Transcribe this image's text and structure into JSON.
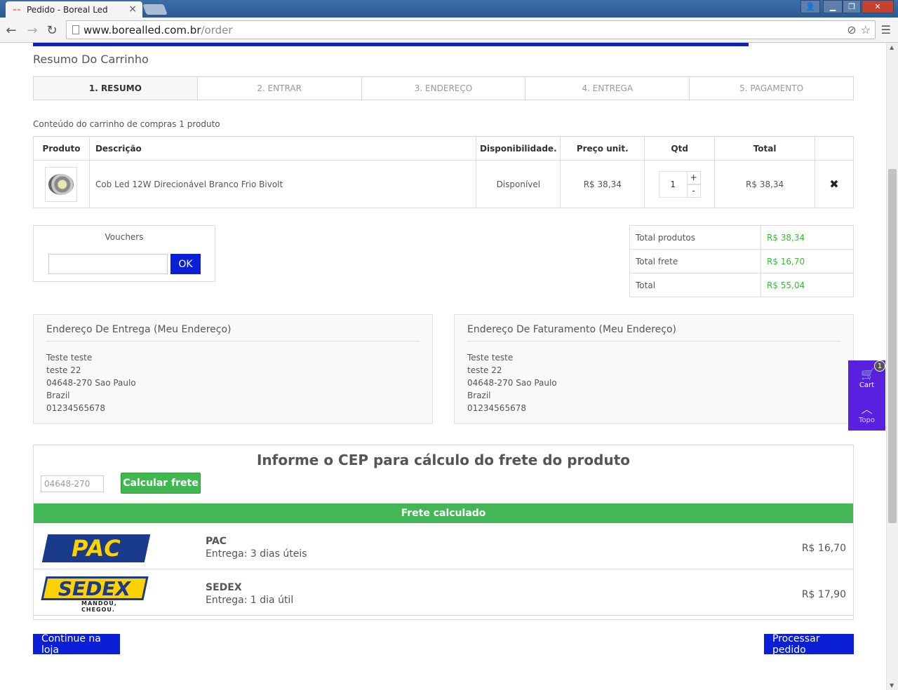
{
  "browser": {
    "tab_title": "Pedido - Boreal Led",
    "url_host": "www.borealled.com.br",
    "url_path": "/order"
  },
  "page": {
    "title": "Resumo Do Carrinho",
    "steps": [
      "1. RESUMO",
      "2. ENTRAR",
      "3. ENDEREÇO",
      "4. ENTREGA",
      "5. PAGAMENTO"
    ],
    "cart_summary": "Conteúdo do carrinho de compras 1 produto"
  },
  "cart_table": {
    "headers": [
      "Produto",
      "Descrição",
      "Disponibilidade.",
      "Preço unit.",
      "Qtd",
      "Total",
      ""
    ],
    "rows": [
      {
        "description": "Cob Led 12W Direcionável Branco Frio Bivolt",
        "availability": "Disponível",
        "unit_price": "R$ 38,34",
        "qty": "1",
        "total": "R$ 38,34"
      }
    ],
    "qty_plus": "+",
    "qty_minus": "-",
    "delete_glyph": "✖"
  },
  "vouchers": {
    "title": "Vouchers",
    "ok_label": "OK",
    "input_value": ""
  },
  "totals": [
    {
      "label": "Total produtos",
      "value": "R$ 38,34"
    },
    {
      "label": "Total frete",
      "value": "R$ 16,70"
    },
    {
      "label": "Total",
      "value": "R$ 55,04"
    }
  ],
  "delivery_address": {
    "title": "Endereço De Entrega (Meu Endereço)",
    "lines": [
      "Teste teste",
      "teste 22",
      "04648-270 Sao Paulo",
      "Brazil",
      "01234565678"
    ]
  },
  "billing_address": {
    "title": "Endereço De Faturamento (Meu Endereço)",
    "lines": [
      "Teste teste",
      "teste 22",
      "04648-270 Sao Paulo",
      "Brazil",
      "01234565678"
    ]
  },
  "side_widget": {
    "cart_label": "Cart",
    "cart_count": "1",
    "top_label": "Topo"
  },
  "freight": {
    "title": "Informe o CEP para cálculo do frete do produto",
    "cep_placeholder": "04648-270",
    "calc_button": "Calcular frete",
    "banner": "Frete calculado",
    "options": [
      {
        "logo": "PAC",
        "name": "PAC",
        "eta": "Entrega: 3 dias úteis",
        "price": "R$ 16,70"
      },
      {
        "logo": "SEDEX",
        "logo_tag": "MANDOU, CHEGOU.",
        "name": "SEDEX",
        "eta": "Entrega: 1 dia útil",
        "price": "R$ 17,90"
      }
    ]
  },
  "actions": {
    "continue": "Continue na loja",
    "process": "Processar pedido"
  },
  "colors": {
    "brand_blue": "#0a1fd6",
    "price_green": "#3dba3d",
    "freight_green": "#43b756",
    "widget_purple": "#5a20e0"
  }
}
